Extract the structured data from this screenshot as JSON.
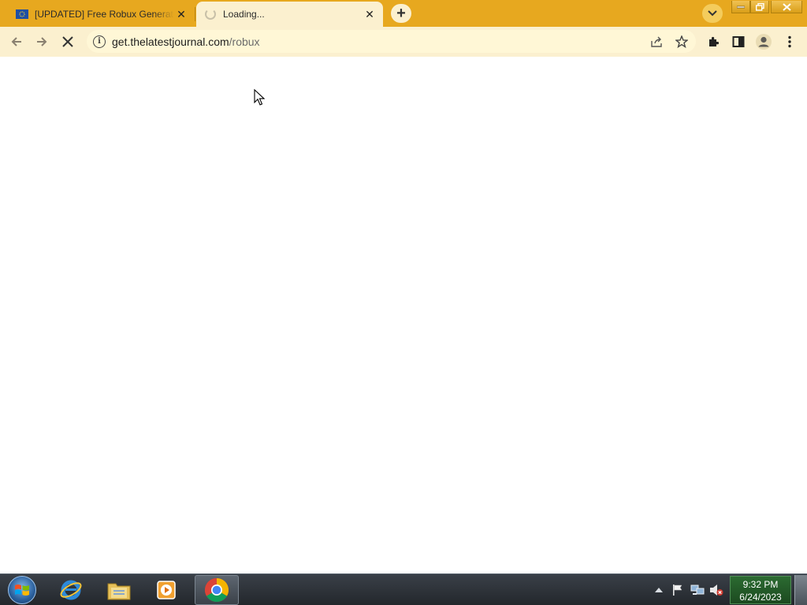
{
  "browser": {
    "tabs": [
      {
        "title": "[UPDATED] Free Robux Generator",
        "state": "inactive",
        "favicon": "flag-favicon"
      },
      {
        "title": "Loading...",
        "state": "active",
        "favicon": "loading-spinner"
      }
    ],
    "address_bar": {
      "host": "get.thelatestjournal.com",
      "path": "/robux"
    },
    "theme_colors": {
      "frame": "#e7a81f",
      "toolbar": "#fbf0cf",
      "omnibox": "#fff7d6"
    }
  },
  "taskbar": {
    "apps": [
      "internet-explorer-icon",
      "file-explorer-icon",
      "media-player-icon",
      "chrome-icon"
    ],
    "clock": {
      "time": "9:32 PM",
      "date": "6/24/2023"
    }
  }
}
